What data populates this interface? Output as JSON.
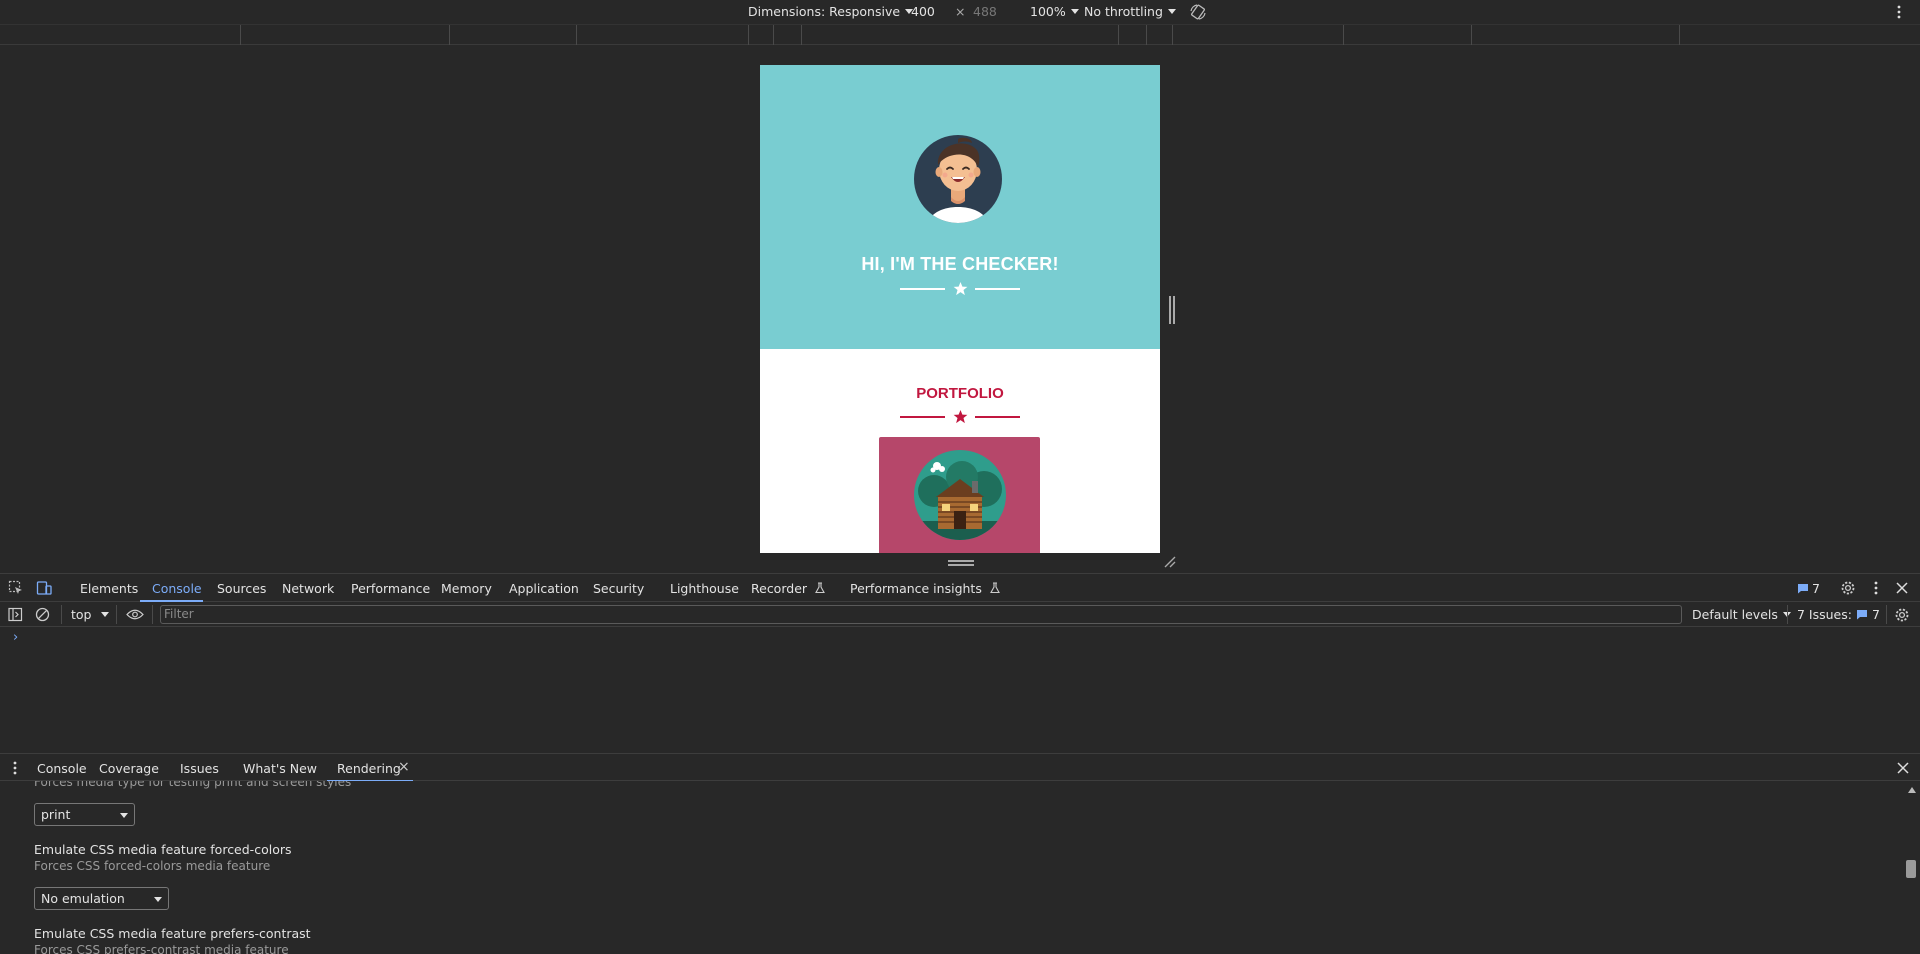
{
  "device_toolbar": {
    "dimensions_label": "Dimensions: Responsive",
    "width_value": "400",
    "times": "×",
    "height_value": "488",
    "zoom": "100%",
    "throttling": "No throttling",
    "rotate_icon": "rotate-icon",
    "more_icon": "kebab-menu-icon"
  },
  "page": {
    "hero_title": "HI, I'M THE CHECKER!",
    "hero_bg": "#79cdd1",
    "portfolio_title": "PORTFOLIO",
    "accent": "#c1173f",
    "card_bg": "#b6476a"
  },
  "devtools": {
    "tabs": [
      "Elements",
      "Console",
      "Sources",
      "Network",
      "Performance",
      "Memory",
      "Application",
      "Security",
      "Lighthouse",
      "Recorder",
      "Performance insights"
    ],
    "active_tab": "Console",
    "issues_count": "7",
    "console_toolbar": {
      "context": "top",
      "filter_placeholder": "Filter",
      "levels": "Default levels",
      "issues_label": "7 Issues:",
      "issues_count": "7"
    },
    "prompt": "›"
  },
  "drawer": {
    "tabs": [
      "Console",
      "Coverage",
      "Issues",
      "What's New",
      "Rendering"
    ],
    "active_tab": "Rendering",
    "close_x": "×",
    "rendering": {
      "partial_sub": "Forces media type for testing print and screen styles",
      "media_select": "print",
      "forced_colors_title": "Emulate CSS media feature forced-colors",
      "forced_colors_sub": "Forces CSS forced-colors media feature",
      "forced_colors_select": "No emulation",
      "prefers_contrast_title": "Emulate CSS media feature prefers-contrast",
      "prefers_contrast_sub": "Forces CSS prefers-contrast media feature"
    }
  }
}
